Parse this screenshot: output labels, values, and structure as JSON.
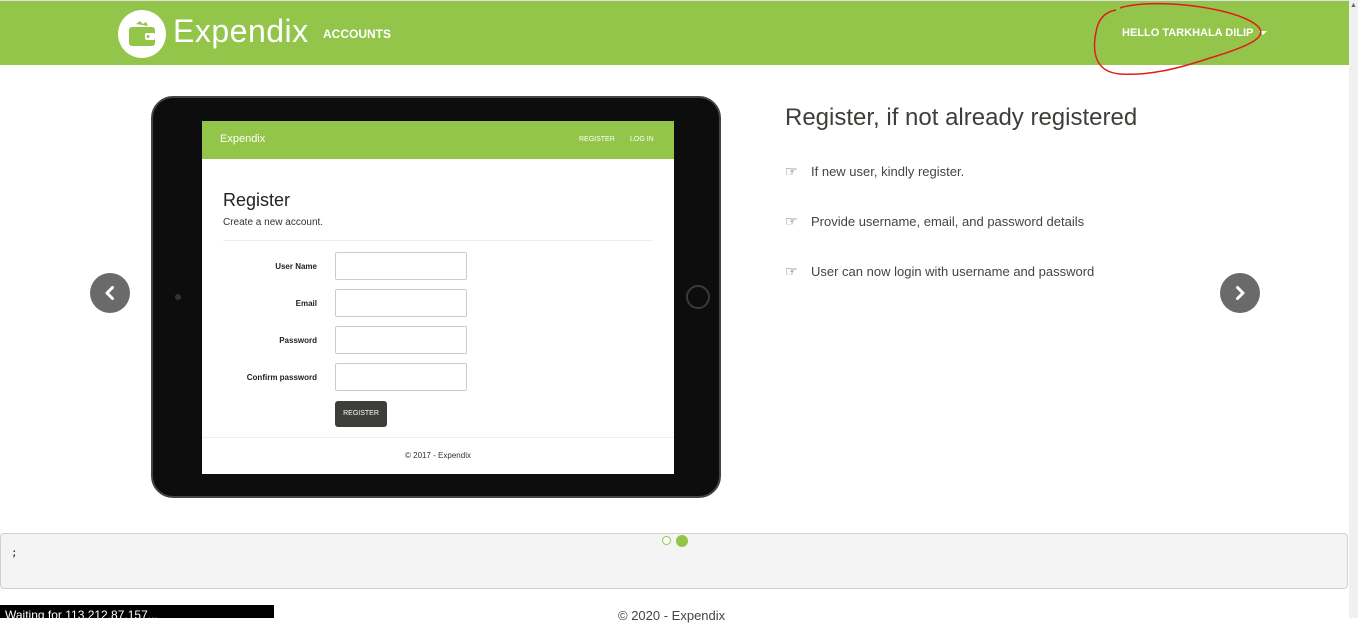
{
  "navbar": {
    "brand": "Expendix",
    "accounts_label": "ACCOUNTS",
    "user_label": "HELLO TARKHALA DILIP",
    "bg_color": "#93c54b"
  },
  "slide": {
    "screen": {
      "brand": "Expendix",
      "register_link": "REGISTER",
      "login_link": "LOG IN",
      "title": "Register",
      "subtitle": "Create a new account.",
      "fields": [
        {
          "label": "User Name"
        },
        {
          "label": "Email"
        },
        {
          "label": "Password"
        },
        {
          "label": "Confirm password"
        }
      ],
      "button_label": "REGISTER",
      "footer": "© 2017 - Expendix"
    },
    "headline": "Register, if not already registered",
    "points": [
      {
        "icon": "hand-point-right-icon",
        "text": "If new user, kindly register."
      },
      {
        "icon": "hand-point-right-icon",
        "text": "Provide username, email, and password details"
      },
      {
        "icon": "hand-point-right-icon",
        "text": "User can now login with username and password"
      }
    ]
  },
  "carousel": {
    "prev_icon": "chevron-left-icon",
    "next_icon": "chevron-right-icon",
    "slides_count": 2,
    "active_index": 1
  },
  "bottom_panel": {
    "text": ";"
  },
  "footer": {
    "text": "© 2020 - Expendix"
  },
  "status_bar": {
    "text": "Waiting for 113.212.87.157..."
  }
}
